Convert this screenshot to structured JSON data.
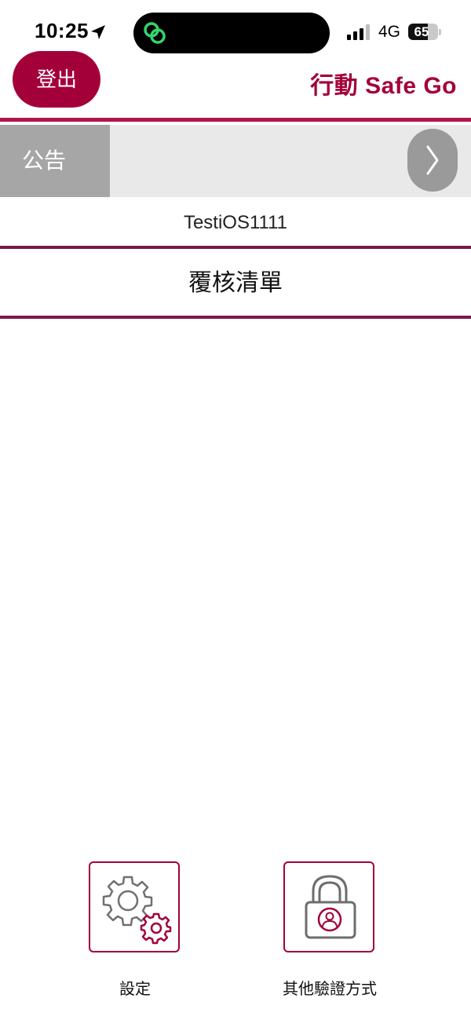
{
  "status_bar": {
    "time": "10:25",
    "network": "4G",
    "battery_level": "65",
    "battery_fraction": 0.65,
    "icons": [
      "location-arrow-icon",
      "app-link-icon",
      "signal-icon",
      "battery-icon"
    ]
  },
  "header": {
    "logout_label": "登出",
    "app_title": "行動 Safe Go",
    "accent_color": "#a3003a"
  },
  "announcement": {
    "label": "公告",
    "text": ""
  },
  "user": {
    "name": "TestiOS1111"
  },
  "review": {
    "label": "覆核清單"
  },
  "bottom_actions": {
    "settings_label": "設定",
    "verify_label": "其他驗證方式"
  }
}
